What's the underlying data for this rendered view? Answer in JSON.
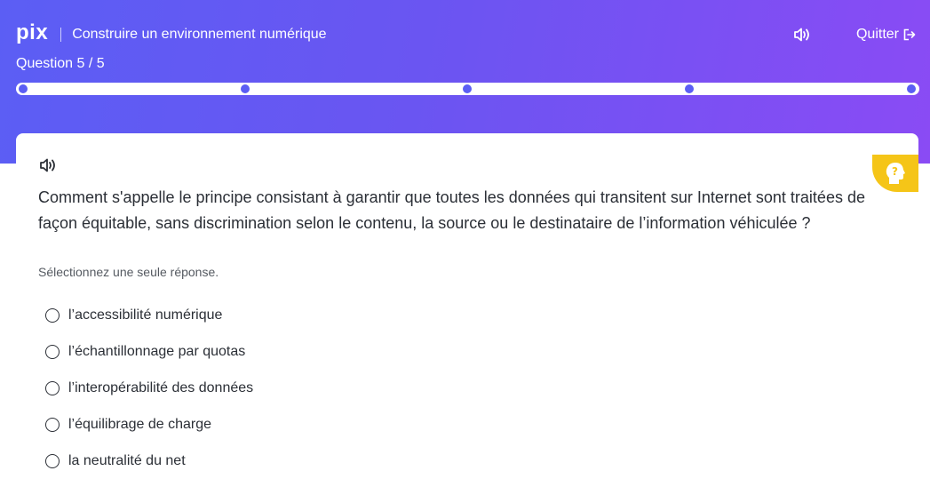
{
  "header": {
    "logo": "pix",
    "assessment_title": "Construire un environnement numérique",
    "quit_label": "Quitter",
    "question_counter": "Question 5 / 5",
    "progress": {
      "current": 5,
      "total": 5
    }
  },
  "challenge": {
    "instruction": "Comment s'appelle le principe consistant à garantir que toutes les données qui transitent sur Internet sont traitées de façon équitable, sans discrimination selon le contenu, la source ou le destinataire de l’information véhiculée ?",
    "hint": "Sélectionnez une seule réponse.",
    "answers": [
      {
        "label": "l’accessibilité numérique"
      },
      {
        "label": "l’échantillonnage par quotas"
      },
      {
        "label": "l’interopérabilité des données"
      },
      {
        "label": "l’équilibrage de charge"
      },
      {
        "label": "la neutralité du net"
      }
    ]
  },
  "colors": {
    "gradient_start": "#5b5ef4",
    "gradient_end": "#8a4bf4",
    "tutorial_tab": "#f5c518"
  },
  "icons": [
    "speaker-icon",
    "exit-icon",
    "question-head-icon"
  ]
}
